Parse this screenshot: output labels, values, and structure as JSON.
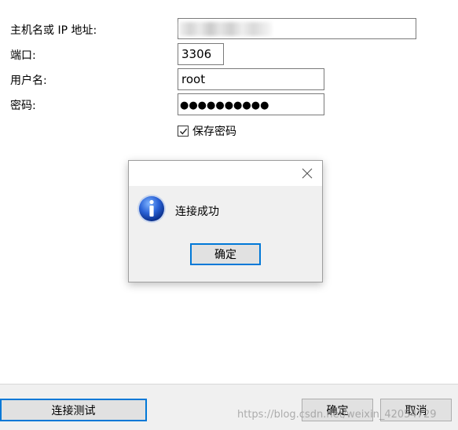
{
  "form": {
    "host_label": "主机名或 IP 地址:",
    "host_value": "",
    "port_label": "端口:",
    "port_value": "3306",
    "user_label": "用户名:",
    "user_value": "root",
    "password_label": "密码:",
    "password_dots": "●●●●●●●●●●",
    "save_password_label": "保存密码",
    "save_password_checked": true
  },
  "dialog": {
    "message": "连接成功",
    "ok_label": "确定",
    "icon": "info-icon",
    "close_icon": "close-icon"
  },
  "footer": {
    "test_connection_label": "连接测试",
    "ok_label": "确定",
    "cancel_label": "取消"
  },
  "watermark": "https://blog.csdn.net/weixin_42054729",
  "colors": {
    "accent": "#0078d7",
    "dialog_bg": "#f0f0f0",
    "button_bg": "#e1e1e1"
  }
}
